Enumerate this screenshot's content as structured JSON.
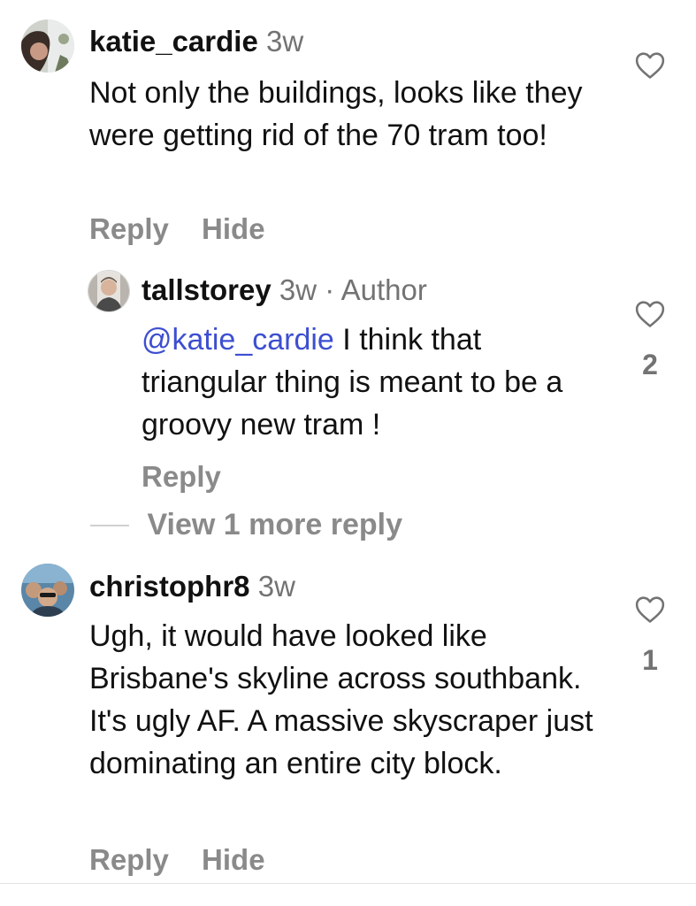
{
  "comments": [
    {
      "username": "katie_cardie",
      "time": "3w",
      "text": "Not only the buildings, looks like they were getting rid of the 70 tram too!",
      "actions": {
        "reply": "Reply",
        "hide": "Hide"
      },
      "like_count": ""
    },
    {
      "username": "tallstorey",
      "time": "3w",
      "separator": "·",
      "author_label": "Author",
      "mention": "@katie_cardie",
      "text": " I think that triangular thing is meant to be a groovy new tram !",
      "actions": {
        "reply": "Reply"
      },
      "like_count": "2"
    },
    {
      "username": "christophr8",
      "time": "3w",
      "text": "Ugh, it would have looked like Brisbane's skyline across southbank. It's ugly AF. A massive skyscraper just dominating an entire city block.",
      "actions": {
        "reply": "Reply",
        "hide": "Hide"
      },
      "like_count": "1"
    }
  ],
  "view_more_replies": "View 1 more reply",
  "icons": {
    "like": "heart-outline-icon"
  },
  "colors": {
    "text": "#111111",
    "muted": "#737373",
    "action": "#8a8a8a",
    "mention": "#3d4fd0"
  }
}
